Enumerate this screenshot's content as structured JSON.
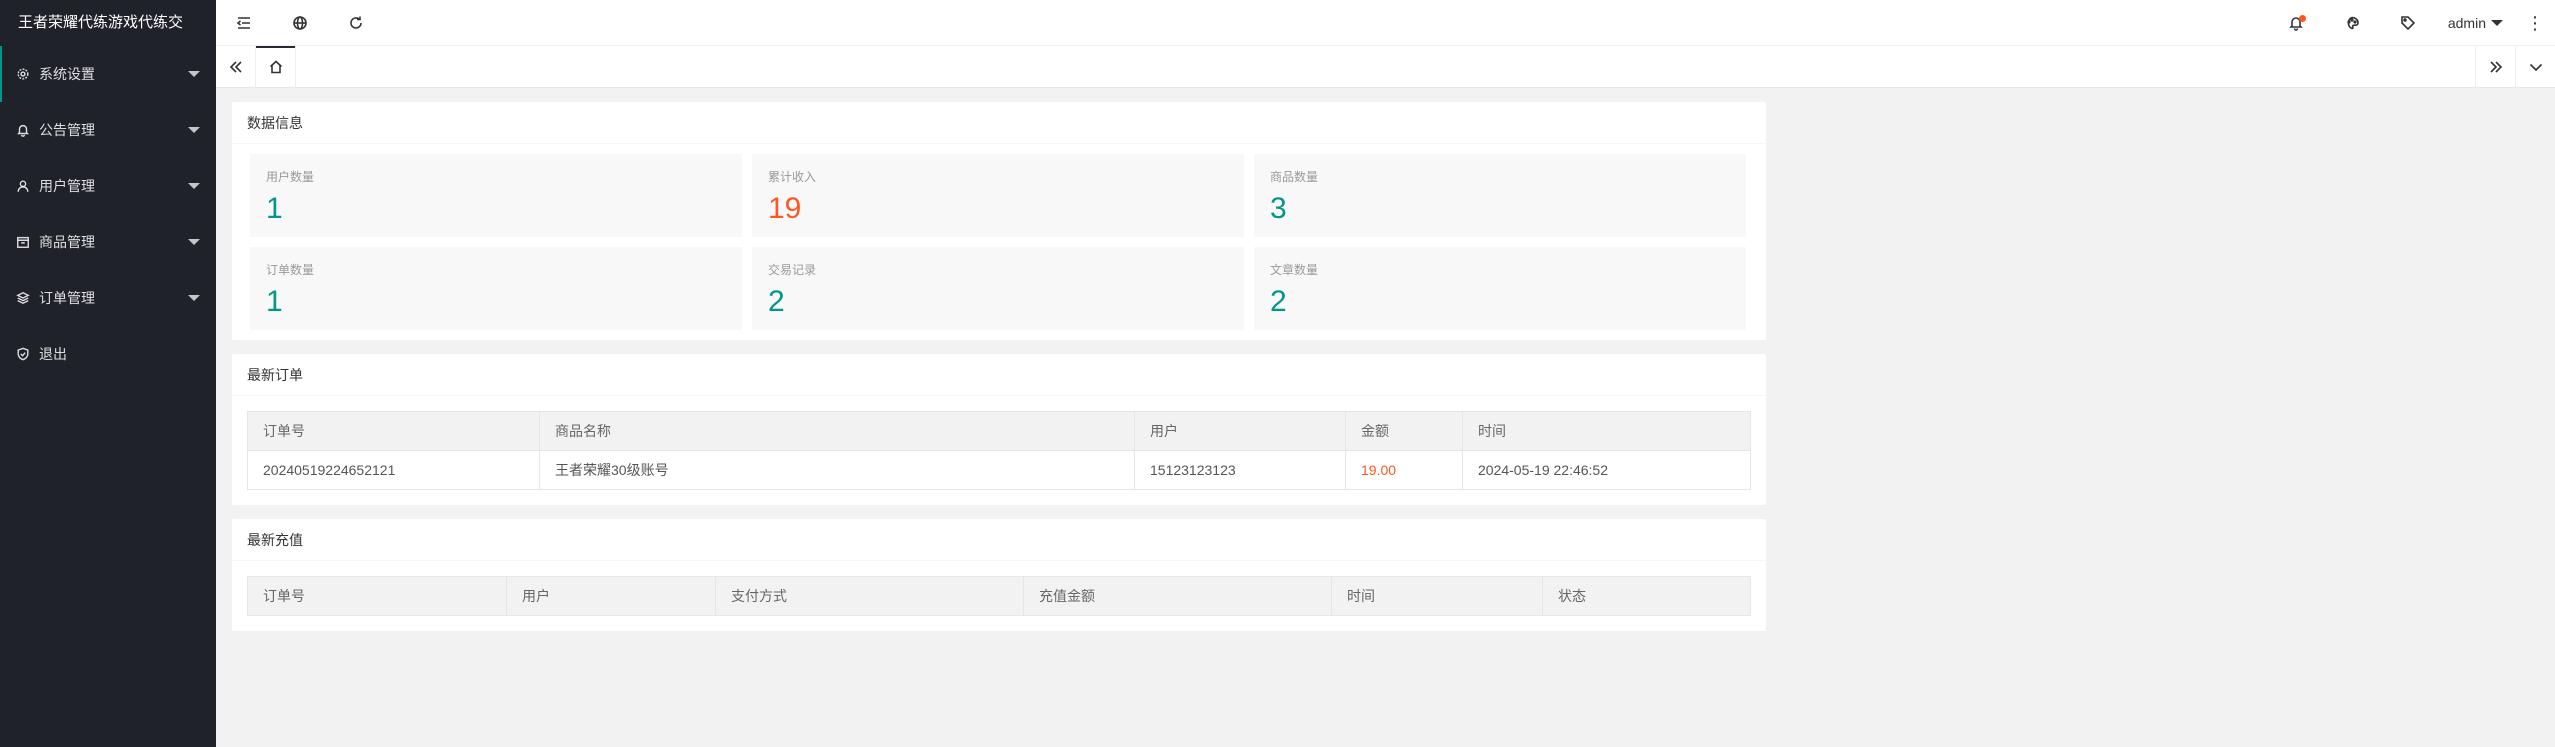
{
  "sidebar": {
    "logo": "王者荣耀代练游戏代练交",
    "items": [
      {
        "label": "系统设置",
        "icon": "gear-icon"
      },
      {
        "label": "公告管理",
        "icon": "bell-icon"
      },
      {
        "label": "用户管理",
        "icon": "user-icon"
      },
      {
        "label": "商品管理",
        "icon": "goods-icon"
      },
      {
        "label": "订单管理",
        "icon": "layers-icon"
      },
      {
        "label": "退出",
        "icon": "shield-icon"
      }
    ]
  },
  "header": {
    "left_icons": [
      "shrink-menu-icon",
      "website-icon",
      "refresh-icon"
    ],
    "right_icons": [
      "notice-bell-icon",
      "theme-icon",
      "tag-icon"
    ],
    "user": "admin",
    "more": "⋮"
  },
  "tabs": {
    "icons": [
      "prev-page-icon",
      "home-icon",
      "next-page-icon",
      "tab-options-icon"
    ]
  },
  "data_info": {
    "title": "数据信息",
    "stats": [
      {
        "label": "用户数量",
        "value": "1"
      },
      {
        "label": "累计收入",
        "value": "19"
      },
      {
        "label": "商品数量",
        "value": "3"
      },
      {
        "label": "订单数量",
        "value": "1"
      },
      {
        "label": "交易记录",
        "value": "2"
      },
      {
        "label": "文章数量",
        "value": "2"
      }
    ]
  },
  "latest_orders": {
    "title": "最新订单",
    "columns": [
      "订单号",
      "商品名称",
      "用户",
      "金额",
      "时间"
    ],
    "rows": [
      [
        "20240519224652121",
        "王者荣耀30级账号",
        "15123123123",
        "19.00",
        "2024-05-19 22:46:52"
      ]
    ]
  },
  "latest_recharge": {
    "title": "最新充值",
    "columns": [
      "订单号",
      "用户",
      "支付方式",
      "充值金额",
      "时间",
      "状态"
    ]
  },
  "colors": {
    "sidebar_bg": "#20222a",
    "accent": "#009688",
    "highlight": "#ff5722"
  }
}
